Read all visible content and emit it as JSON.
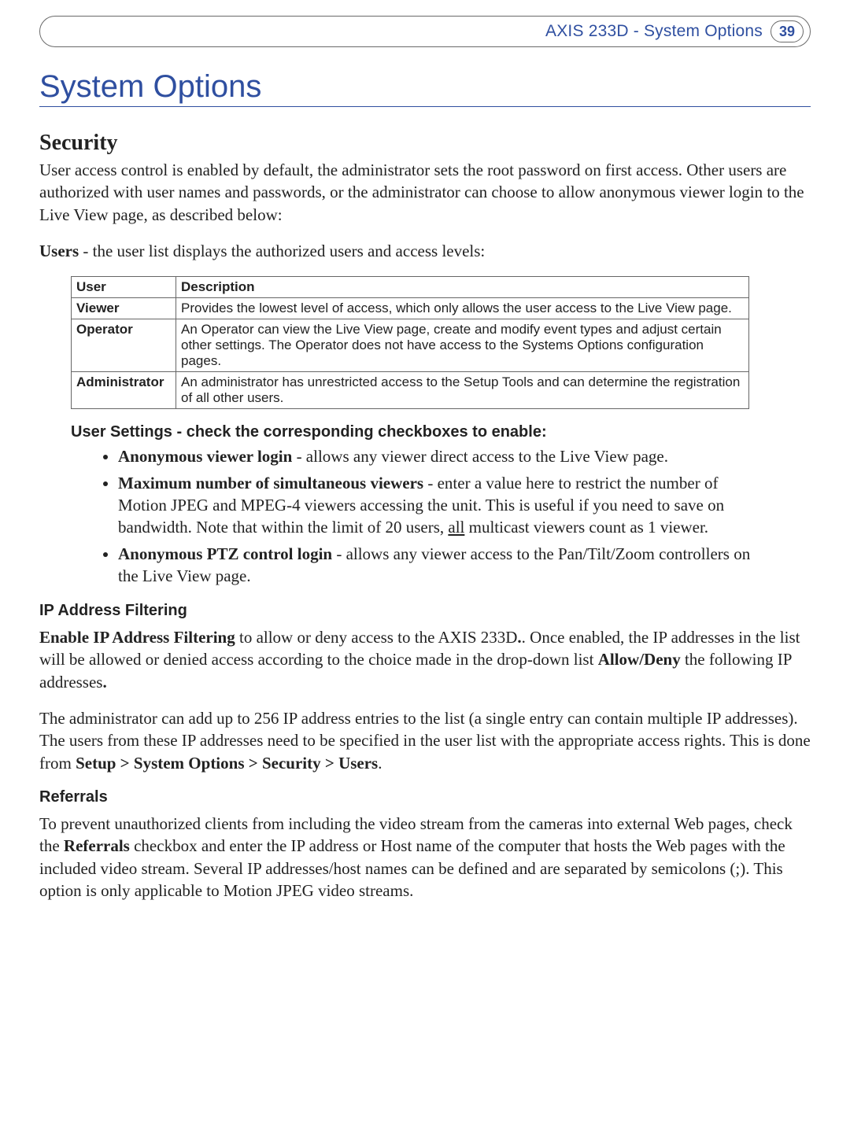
{
  "header": {
    "product_section": "AXIS 233D - System Options",
    "page_number": "39"
  },
  "title": "System Options",
  "security": {
    "heading": "Security",
    "intro": "User access control is enabled by default, the administrator sets the root password on first access. Other users are authorized with user names and passwords, or the administrator can choose to allow anonymous viewer login to the Live View page, as described below:",
    "users_label": "Users",
    "users_desc": " - the user list displays the authorized users and access levels:",
    "table": {
      "col_user": "User",
      "col_desc": "Description",
      "rows": [
        {
          "user": "Viewer",
          "desc": "Provides the lowest level of access, which only allows the user access to the Live View page."
        },
        {
          "user": "Operator",
          "desc": "An Operator can view the Live View page, create and modify event types and adjust certain other settings. The Operator does not have access to the Systems Options configuration pages."
        },
        {
          "user": "Administrator",
          "desc": "An administrator has unrestricted access to the Setup Tools and can determine the registration of all other users."
        }
      ]
    },
    "user_settings_heading": "User Settings - check the corresponding checkboxes to enable:",
    "bullets": {
      "b1_label": "Anonymous viewer login",
      "b1_rest": " - allows any viewer direct access to the Live View page.",
      "b2_label": "Maximum number of simultaneous viewers",
      "b2_rest_a": " - enter a value here to restrict the number of Motion JPEG and MPEG-4 viewers accessing the unit. This is useful if you need to save on bandwidth. Note that within the limit of 20 users, ",
      "b2_all": "all",
      "b2_rest_b": " multicast viewers count as 1 viewer.",
      "b3_label": "Anonymous PTZ control login",
      "b3_rest": " - allows any viewer access to the Pan/Tilt/Zoom controllers on the Live View page."
    },
    "ip_filtering": {
      "heading": "IP Address Filtering",
      "p1_label": "Enable IP Address Filtering",
      "p1_rest_a": " to allow or deny access to the AXIS 233D",
      "p1_rest_b": ". Once enabled, the IP addresses in the list will be allowed or denied access according to the choice made in the drop-down list ",
      "p1_allowdeny": "Allow/Deny",
      "p1_rest_c": " the following IP addresses",
      "p1_rest_d": ".",
      "p2_a": "The administrator can add up to 256 IP address entries to the list (a single entry can contain multiple IP addresses). The users from these IP addresses need to be specified in the user list with the appropriate access rights. This is done from ",
      "p2_path": "Setup > System Options > Security > Users",
      "p2_end": "."
    },
    "referrals": {
      "heading": "Referrals",
      "p_a": "To prevent unauthorized clients from including the video stream from the cameras into external Web pages, check the ",
      "p_label": "Referrals",
      "p_b": " checkbox and enter the IP address or Host name of the computer that hosts the Web pages with the included video stream. Several IP addresses/host names can be defined and are separated by semicolons (;). This option is only applicable to Motion JPEG video streams."
    }
  }
}
